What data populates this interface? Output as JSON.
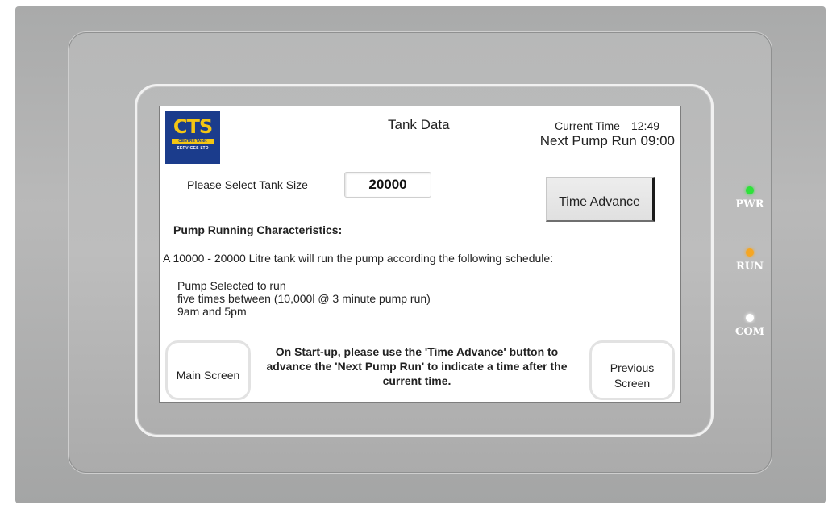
{
  "device": {
    "leds": [
      {
        "label": "PWR",
        "color": "#2ee23a"
      },
      {
        "label": "RUN",
        "color": "#f5a623"
      },
      {
        "label": "COM",
        "color": "#ffffff"
      }
    ]
  },
  "logo": {
    "mark": "CTS",
    "band": "CENTRE TANK",
    "sub": "SERVICES LTD"
  },
  "header": {
    "title": "Tank Data",
    "current_time_label": "Current Time",
    "current_time_value": "12:49",
    "next_pump_run": "Next Pump Run 09:00"
  },
  "tank_size": {
    "label": "Please Select Tank Size",
    "value": "20000"
  },
  "buttons": {
    "time_advance": "Time Advance",
    "main_screen": "Main Screen",
    "previous_screen": "Previous Screen"
  },
  "characteristics": {
    "heading": "Pump Running Characteristics:",
    "schedule_text": "A 10000 - 20000  Litre tank will run the pump according the following schedule:",
    "lines": [
      "Pump Selected to run",
      "five times between (10,000l @ 3 minute pump run)",
      "9am and 5pm"
    ]
  },
  "startup_note": "On Start-up, please use the 'Time Advance' button to advance the 'Next Pump Run' to indicate a time after the current time."
}
